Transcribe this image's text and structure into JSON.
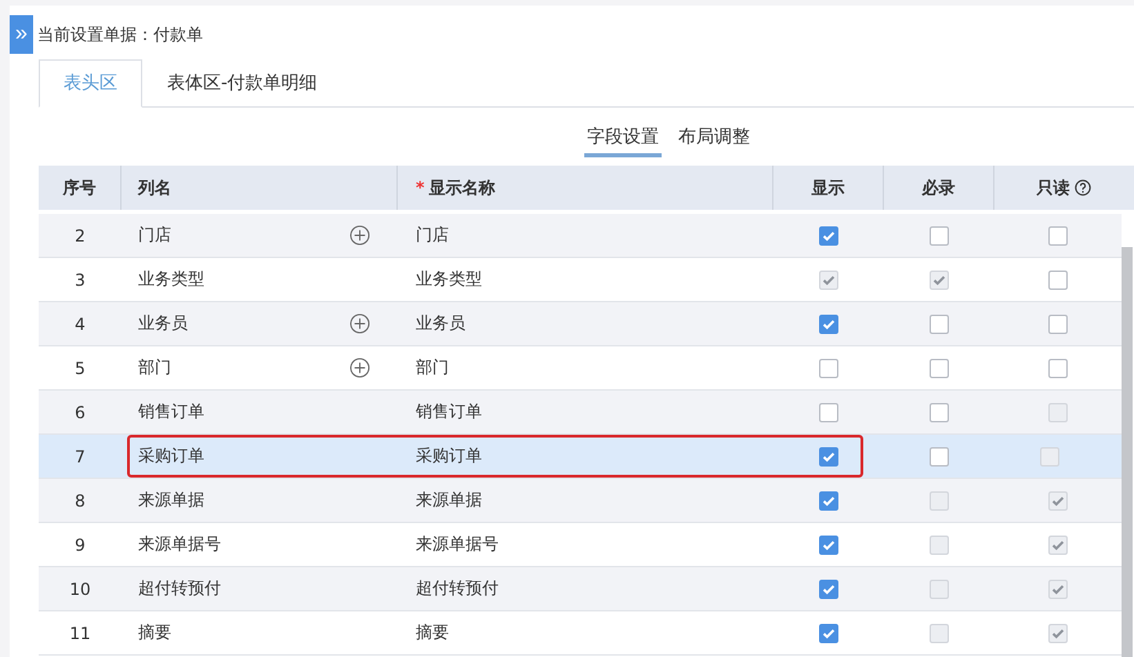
{
  "toggle": {
    "icon": "»"
  },
  "header": {
    "label": "当前设置单据：付款单"
  },
  "tabs": [
    {
      "label": "表头区",
      "selected": true
    },
    {
      "label": "表体区-付款单明细",
      "selected": false
    }
  ],
  "subtabs": [
    {
      "label": "字段设置",
      "selected": true
    },
    {
      "label": "布局调整",
      "selected": false
    }
  ],
  "table": {
    "columns": [
      {
        "label": "序号",
        "help": false
      },
      {
        "label": "列名",
        "help": false
      },
      {
        "label": "显示名称",
        "mark": "*",
        "help": false
      },
      {
        "label": "显示",
        "help": false
      },
      {
        "label": "必录",
        "help": false
      },
      {
        "label": "只读",
        "help": true
      }
    ],
    "rows": [
      {
        "no": "2",
        "name": "门店",
        "addable": true,
        "display_name": "门店",
        "selected": false,
        "highlighted": false,
        "show": {
          "checked": true,
          "disabled": false
        },
        "required": {
          "checked": false,
          "disabled": false
        },
        "readonly": {
          "checked": false,
          "disabled": false
        }
      },
      {
        "no": "3",
        "name": "业务类型",
        "addable": false,
        "display_name": "业务类型",
        "selected": false,
        "highlighted": false,
        "show": {
          "checked": true,
          "disabled": true
        },
        "required": {
          "checked": true,
          "disabled": true
        },
        "readonly": {
          "checked": false,
          "disabled": false
        }
      },
      {
        "no": "4",
        "name": "业务员",
        "addable": true,
        "display_name": "业务员",
        "selected": false,
        "highlighted": false,
        "show": {
          "checked": true,
          "disabled": false
        },
        "required": {
          "checked": false,
          "disabled": false
        },
        "readonly": {
          "checked": false,
          "disabled": false
        }
      },
      {
        "no": "5",
        "name": "部门",
        "addable": true,
        "display_name": "部门",
        "selected": false,
        "highlighted": false,
        "show": {
          "checked": false,
          "disabled": false
        },
        "required": {
          "checked": false,
          "disabled": false
        },
        "readonly": {
          "checked": false,
          "disabled": false
        }
      },
      {
        "no": "6",
        "name": "销售订单",
        "addable": false,
        "display_name": "销售订单",
        "selected": false,
        "highlighted": false,
        "show": {
          "checked": false,
          "disabled": false
        },
        "required": {
          "checked": false,
          "disabled": false
        },
        "readonly": {
          "checked": false,
          "disabled": true
        }
      },
      {
        "no": "7",
        "name": "采购订单",
        "addable": false,
        "display_name": "采购订单",
        "selected": true,
        "highlighted": true,
        "show": {
          "checked": true,
          "disabled": false
        },
        "required": {
          "checked": false,
          "disabled": false
        },
        "readonly": {
          "checked": false,
          "disabled": true
        }
      },
      {
        "no": "8",
        "name": "来源单据",
        "addable": false,
        "display_name": "来源单据",
        "selected": false,
        "highlighted": false,
        "show": {
          "checked": true,
          "disabled": false
        },
        "required": {
          "checked": false,
          "disabled": true
        },
        "readonly": {
          "checked": true,
          "disabled": true
        }
      },
      {
        "no": "9",
        "name": "来源单据号",
        "addable": false,
        "display_name": "来源单据号",
        "selected": false,
        "highlighted": false,
        "show": {
          "checked": true,
          "disabled": false
        },
        "required": {
          "checked": false,
          "disabled": true
        },
        "readonly": {
          "checked": true,
          "disabled": true
        }
      },
      {
        "no": "10",
        "name": "超付转预付",
        "addable": false,
        "display_name": "超付转预付",
        "selected": false,
        "highlighted": false,
        "show": {
          "checked": true,
          "disabled": false
        },
        "required": {
          "checked": false,
          "disabled": true
        },
        "readonly": {
          "checked": true,
          "disabled": true
        }
      },
      {
        "no": "11",
        "name": "摘要",
        "addable": false,
        "display_name": "摘要",
        "selected": false,
        "highlighted": false,
        "show": {
          "checked": true,
          "disabled": false
        },
        "required": {
          "checked": false,
          "disabled": true
        },
        "readonly": {
          "checked": true,
          "disabled": true
        }
      }
    ]
  }
}
